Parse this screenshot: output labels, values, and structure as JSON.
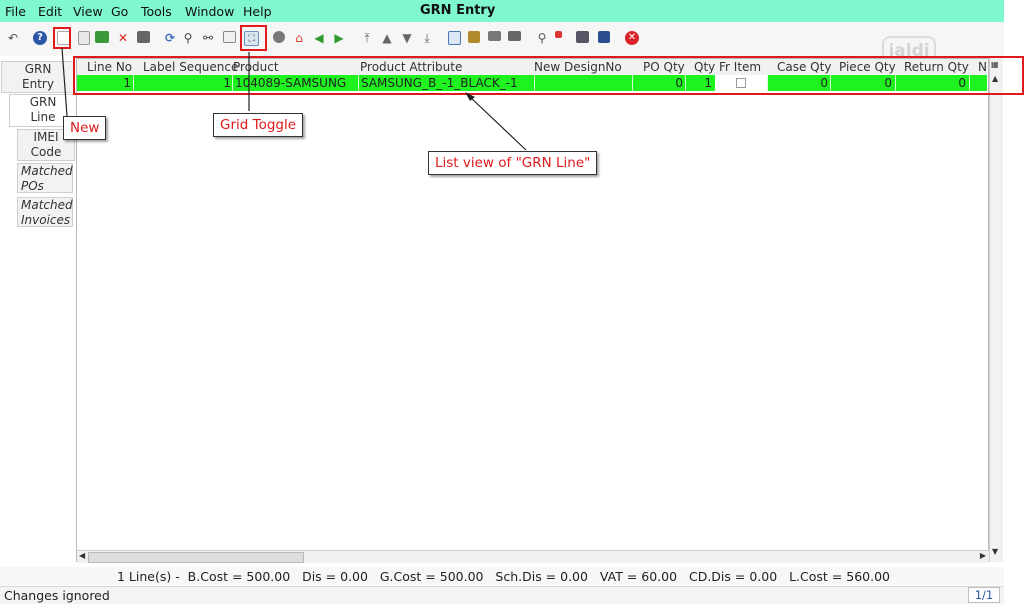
{
  "window": {
    "title": "GRN Entry"
  },
  "menu": {
    "file": "File",
    "edit": "Edit",
    "view": "View",
    "go": "Go",
    "tools": "Tools",
    "window": "Window",
    "help": "Help"
  },
  "watermark": "jaldi",
  "tabs": [
    "GRN Entry",
    "GRN Line",
    "IMEI Code",
    "Matched POs",
    "Matched Invoices"
  ],
  "tab_lines": [
    [
      "GRN",
      "Entry"
    ],
    [
      "GRN",
      "Line"
    ],
    [
      "IMEI",
      "Code"
    ],
    [
      "Matched",
      "POs"
    ],
    [
      "Matched",
      "Invoices"
    ]
  ],
  "grid": {
    "columns": [
      "Line No",
      "Label Sequence",
      "Product",
      "Product Attribute",
      "New DesignNo",
      "PO Qty",
      "Qty",
      "Fr Item",
      "Case Qty",
      "Piece Qty",
      "Return Qty",
      "N"
    ],
    "rows": [
      {
        "line_no": "1",
        "label_sequence": "1",
        "product": "104089-SAMSUNG",
        "product_attribute": "SAMSUNG_B_-1_BLACK_-1",
        "new_design_no": "",
        "po_qty": "0",
        "qty": "1",
        "fr_item": false,
        "case_qty": "0",
        "piece_qty": "0",
        "return_qty": "0"
      }
    ]
  },
  "summary": "1 Line(s) -  B.Cost = 500.00   Dis = 0.00   G.Cost = 500.00   Sch.Dis = 0.00   VAT = 60.00   CD.Dis = 0.00   L.Cost = 560.00",
  "status": {
    "message": "Changes ignored",
    "page": "1/1"
  },
  "annotations": {
    "new": "New",
    "grid_toggle": "Grid Toggle",
    "list_view": "List view of \"GRN Line\""
  },
  "colors": {
    "menubar": "#7ff7cf",
    "selected_row": "#1ff31f",
    "annotation": "#e0191c"
  }
}
